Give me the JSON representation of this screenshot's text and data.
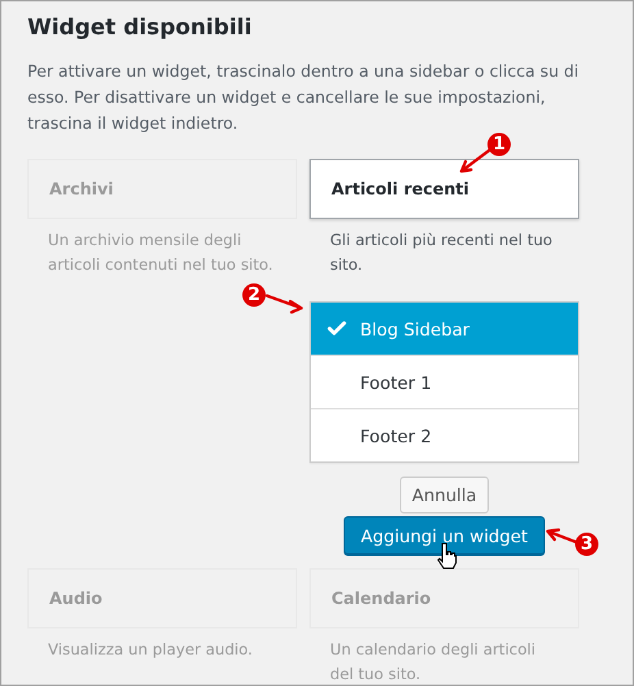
{
  "title": "Widget disponibili",
  "intro": "Per attivare un widget, trascinalo dentro a una sidebar o clicca su di esso. Per disattivare un widget e cancellare le sue impostazioni, trascina il widget indietro.",
  "widgets": [
    {
      "name": "Archivi",
      "description": "Un archivio mensile degli articoli contenuti nel tuo sito.",
      "active": false
    },
    {
      "name": "Articoli recenti",
      "description": "Gli articoli più recenti nel tuo sito.",
      "active": true
    },
    {
      "name": "Audio",
      "description": "Visualizza un player audio.",
      "active": false
    },
    {
      "name": "Calendario",
      "description": "Un calendario degli articoli del tuo sito.",
      "active": false
    }
  ],
  "chooser": {
    "sidebars": [
      {
        "label": "Blog Sidebar",
        "selected": true
      },
      {
        "label": "Footer 1",
        "selected": false
      },
      {
        "label": "Footer 2",
        "selected": false
      }
    ],
    "cancel": "Annulla",
    "add": "Aggiungi un widget"
  },
  "annotations": [
    {
      "number": "1"
    },
    {
      "number": "2"
    },
    {
      "number": "3"
    }
  ]
}
